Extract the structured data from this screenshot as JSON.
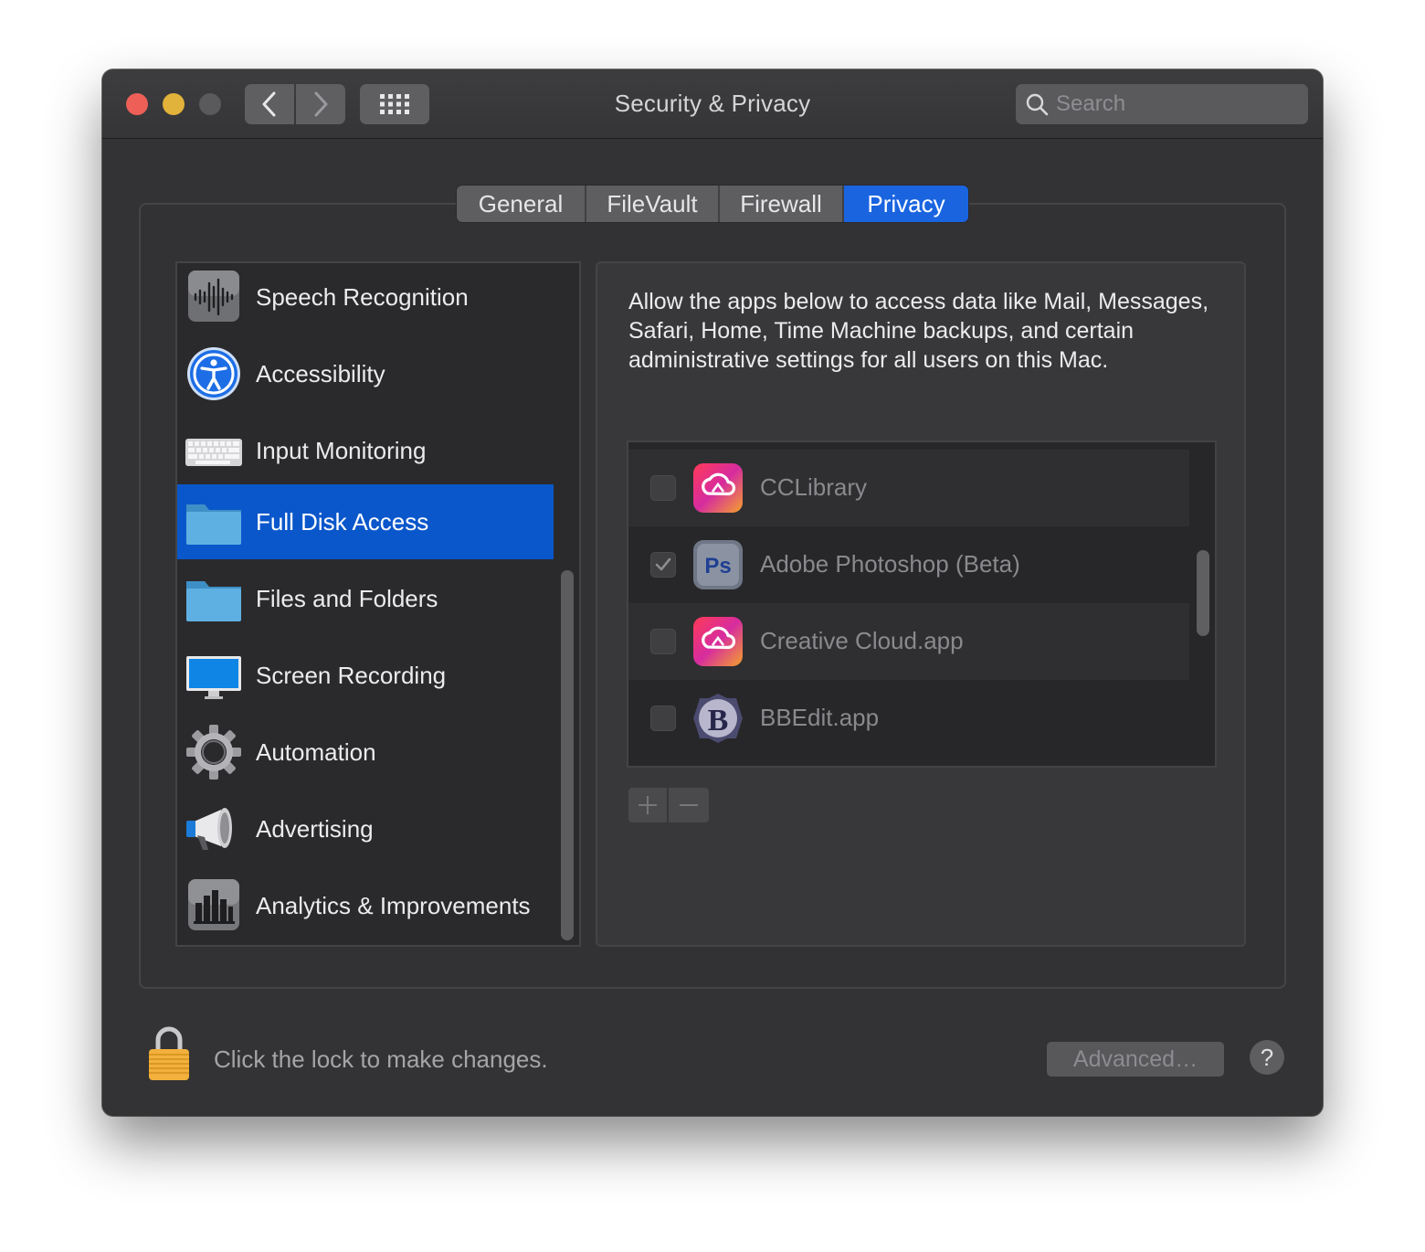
{
  "window": {
    "title": "Security & Privacy",
    "search_placeholder": "Search"
  },
  "tabs": [
    {
      "label": "General",
      "active": false
    },
    {
      "label": "FileVault",
      "active": false
    },
    {
      "label": "Firewall",
      "active": false
    },
    {
      "label": "Privacy",
      "active": true
    }
  ],
  "sidebar": {
    "items": [
      {
        "label": "Speech Recognition",
        "icon": "waveform-icon",
        "selected": false
      },
      {
        "label": "Accessibility",
        "icon": "accessibility-icon",
        "selected": false
      },
      {
        "label": "Input Monitoring",
        "icon": "keyboard-icon",
        "selected": false
      },
      {
        "label": "Full Disk Access",
        "icon": "folder-icon",
        "selected": true
      },
      {
        "label": "Files and Folders",
        "icon": "folder-icon",
        "selected": false
      },
      {
        "label": "Screen Recording",
        "icon": "monitor-icon",
        "selected": false
      },
      {
        "label": "Automation",
        "icon": "gear-icon",
        "selected": false
      },
      {
        "label": "Advertising",
        "icon": "megaphone-icon",
        "selected": false
      },
      {
        "label": "Analytics & Improvements",
        "icon": "bar-chart-icon",
        "selected": false
      }
    ]
  },
  "panel": {
    "description": "Allow the apps below to access data like Mail, Messages, Safari, Home, Time Machine backups, and certain administrative settings for all users on this Mac.",
    "apps": [
      {
        "label": "CCLibrary",
        "icon": "creative-cloud-icon",
        "checked": false
      },
      {
        "label": "Adobe Photoshop (Beta)",
        "icon": "photoshop-icon",
        "checked": true
      },
      {
        "label": "Creative Cloud.app",
        "icon": "creative-cloud-icon",
        "checked": false
      },
      {
        "label": "BBEdit.app",
        "icon": "bbedit-icon",
        "checked": false
      }
    ],
    "add_symbol": "+",
    "remove_symbol": "−"
  },
  "footer": {
    "lock_text": "Click the lock to make changes.",
    "advanced_label": "Advanced…",
    "help_label": "?"
  },
  "colors": {
    "accent": "#1a64e0",
    "selected_row": "#0a57cb",
    "window_bg": "#333335",
    "close": "#ed5f57",
    "minimize": "#e2b33a",
    "lock": "#f2b13c"
  }
}
